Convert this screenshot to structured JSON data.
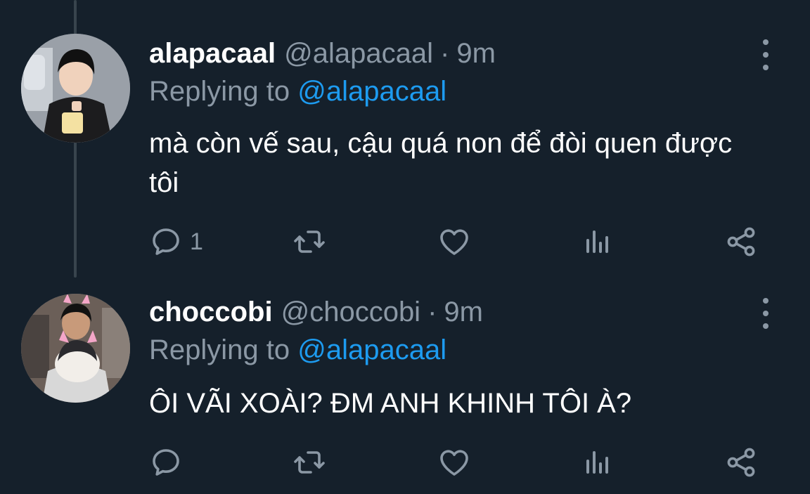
{
  "tweets": [
    {
      "display_name": "alapacaal",
      "handle": "@alapacaal",
      "separator": "·",
      "time": "9m",
      "replying_label": "Replying to",
      "replying_to": "@alapacaal",
      "text": "mà còn vế sau, cậu quá non để đòi quen được tôi",
      "reply_count": "1",
      "icons": {
        "reply": "reply-icon",
        "retweet": "retweet-icon",
        "like": "heart-icon",
        "views": "views-icon",
        "share": "share-icon",
        "more": "more-icon"
      }
    },
    {
      "display_name": "choccobi",
      "handle": "@choccobi",
      "separator": "·",
      "time": "9m",
      "replying_label": "Replying to",
      "replying_to": "@alapacaal",
      "text": "ÔI VÃI XOÀI? ĐM ANH KHINH TÔI À?",
      "reply_count": "",
      "icons": {
        "reply": "reply-icon",
        "retweet": "retweet-icon",
        "like": "heart-icon",
        "views": "views-icon",
        "share": "share-icon",
        "more": "more-icon"
      }
    }
  ],
  "colors": {
    "background": "#15202b",
    "text": "#ffffff",
    "secondary": "#8b98a5",
    "link": "#1d9bf0",
    "thread_line": "#38444d"
  }
}
